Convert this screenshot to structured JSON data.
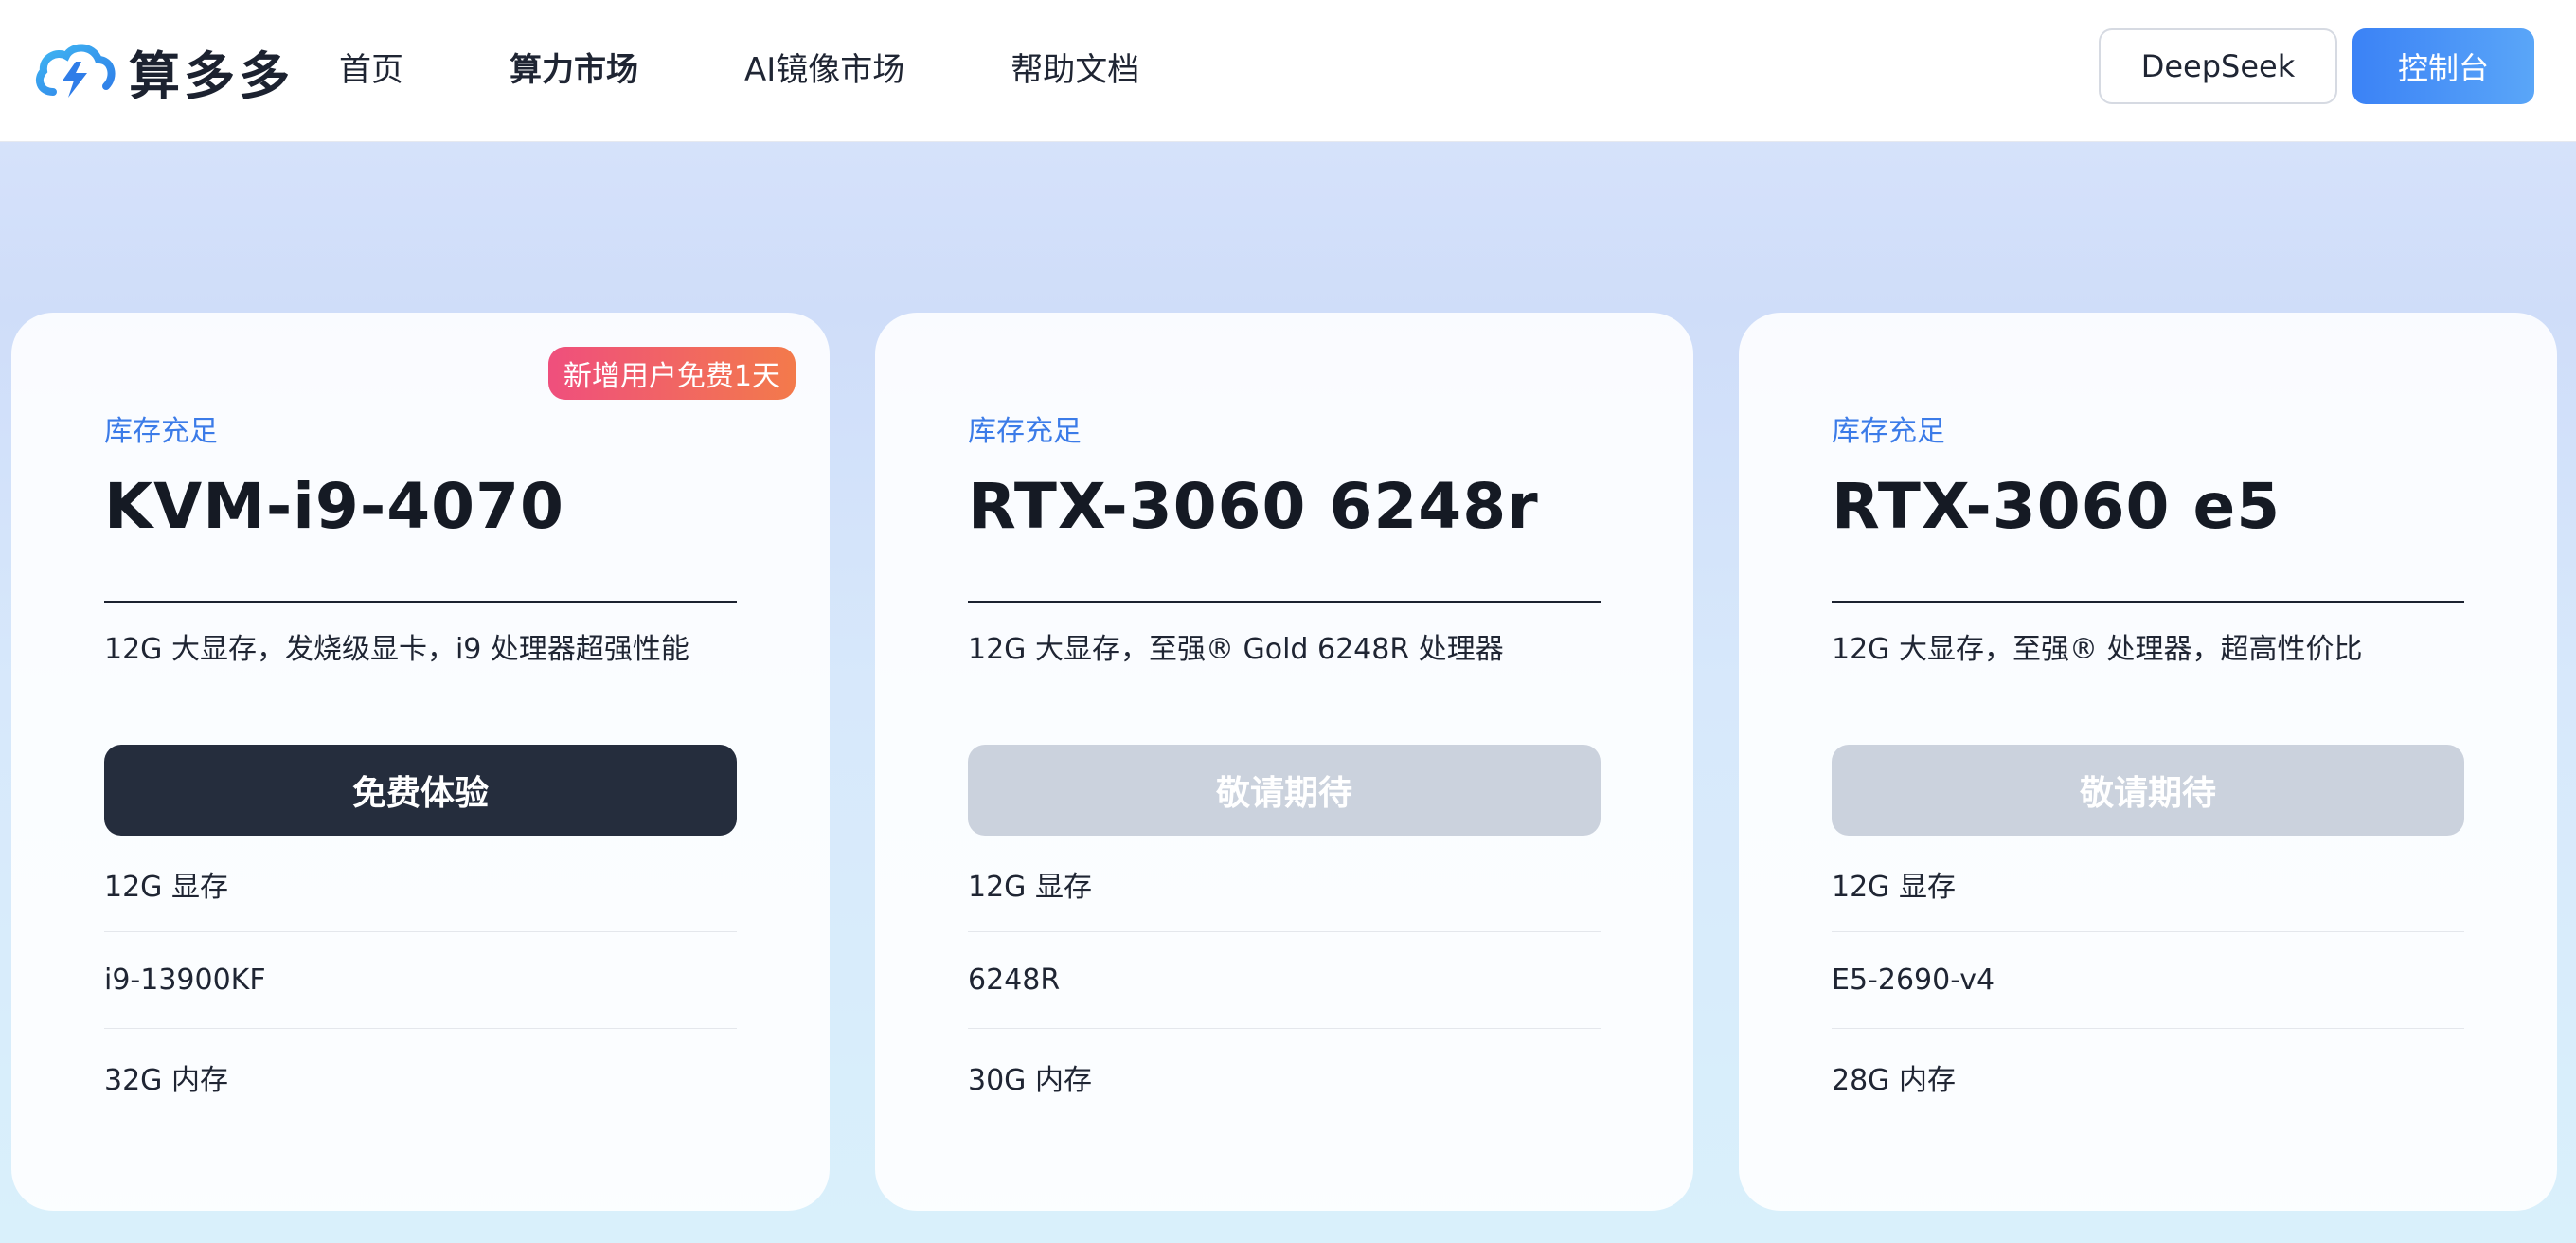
{
  "header": {
    "logo_text": "算多多",
    "nav": [
      {
        "label": "首页",
        "active": false
      },
      {
        "label": "算力市场",
        "active": true
      },
      {
        "label": "AI镜像市场",
        "active": false
      },
      {
        "label": "帮助文档",
        "active": false
      }
    ],
    "deepseek_label": "DeepSeek",
    "console_label": "控制台"
  },
  "cards": [
    {
      "badge": "新增用户免费1天",
      "stock": "库存充足",
      "model": "KVM-i9-4070",
      "description": "12G 大显存，发烧级显卡，i9 处理器超强性能",
      "cta": "免费体验",
      "cta_state": "enabled",
      "specs": [
        "12G 显存",
        "i9-13900KF",
        "32G 内存"
      ]
    },
    {
      "stock": "库存充足",
      "model": "RTX-3060 6248r",
      "description": "12G 大显存，至强® Gold 6248R 处理器",
      "cta": "敬请期待",
      "cta_state": "disabled",
      "specs": [
        "12G 显存",
        "6248R",
        "30G 内存"
      ]
    },
    {
      "stock": "库存充足",
      "model": "RTX-3060 e5",
      "description": "12G 大显存，至强® 处理器，超高性价比",
      "cta": "敬请期待",
      "cta_state": "disabled",
      "specs": [
        "12G 显存",
        "E5-2690-v4",
        "28G 内存"
      ]
    }
  ],
  "colors": {
    "accent": "#3b82f6",
    "stock_text": "#3b7be8",
    "primary_button": "#252d3d",
    "disabled_button": "#cbd2dd",
    "badge_start": "#ef4f7d",
    "badge_end": "#f37a4b"
  }
}
